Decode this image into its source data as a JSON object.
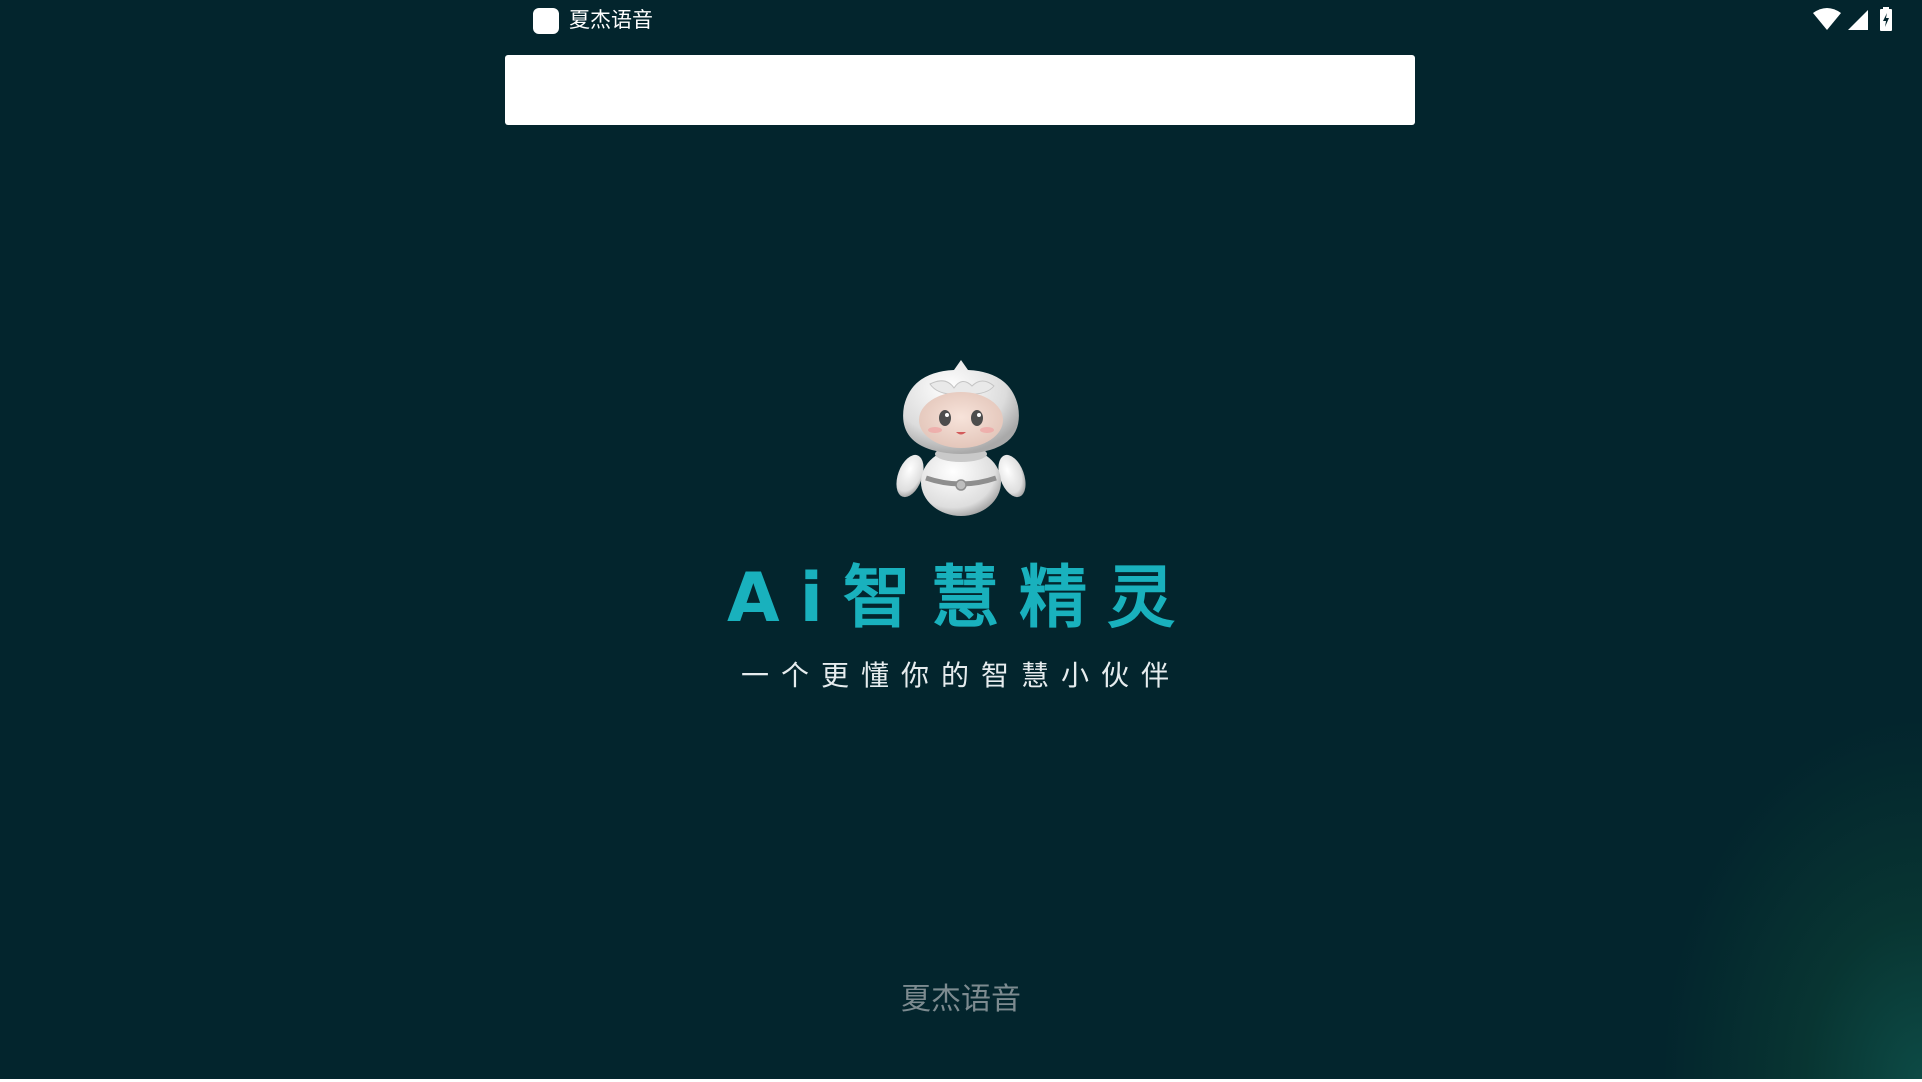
{
  "status_bar": {
    "app_name": "夏杰语音",
    "icons": [
      "wifi-icon",
      "cellular-signal-icon",
      "battery-charging-icon"
    ]
  },
  "search_bar": {
    "value": ""
  },
  "splash": {
    "mascot": "robot-mascot",
    "title": "Ai智慧精灵",
    "subtitle": "一个更懂你的智慧小伙伴",
    "footer_brand": "夏杰语音"
  },
  "colors": {
    "background": "#03252d",
    "title_accent": "#19b1bd",
    "subtitle": "#e6ecee",
    "footer": "#7d8b90"
  }
}
